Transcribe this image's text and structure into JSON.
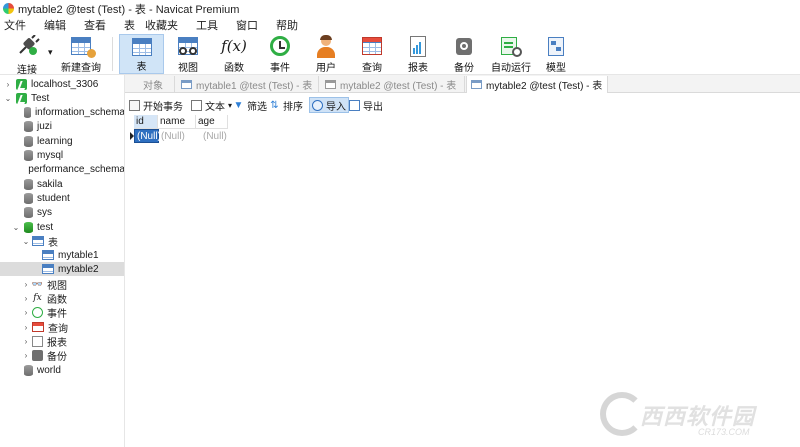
{
  "window": {
    "title": "mytable2 @test (Test) - 表 - Navicat Premium"
  },
  "menu": [
    "文件",
    "编辑",
    "查看",
    "表",
    "收藏夹",
    "工具",
    "窗口",
    "帮助"
  ],
  "ribbon": {
    "connect": "连接",
    "new_query": "新建查询",
    "table": "表",
    "view": "视图",
    "function": "函数",
    "event": "事件",
    "user": "用户",
    "query": "查询",
    "report": "报表",
    "backup": "备份",
    "automation": "自动运行",
    "model": "模型",
    "function_glyph": "f(x)"
  },
  "tree": {
    "items": [
      {
        "label": "localhost_3306",
        "type": "connection",
        "expand": "›"
      },
      {
        "label": "Test",
        "type": "connection",
        "expand": "⌄"
      },
      {
        "label": "information_schema",
        "type": "db"
      },
      {
        "label": "juzi",
        "type": "db"
      },
      {
        "label": "learning",
        "type": "db"
      },
      {
        "label": "mysql",
        "type": "db"
      },
      {
        "label": "performance_schema",
        "type": "db"
      },
      {
        "label": "sakila",
        "type": "db"
      },
      {
        "label": "student",
        "type": "db"
      },
      {
        "label": "sys",
        "type": "db"
      },
      {
        "label": "test",
        "type": "db-open",
        "expand": "⌄"
      },
      {
        "label": "表",
        "type": "folder-table",
        "expand": "⌄"
      },
      {
        "label": "mytable1",
        "type": "table"
      },
      {
        "label": "mytable2",
        "type": "table",
        "selected": true
      },
      {
        "label": "视图",
        "type": "folder",
        "expand": "›"
      },
      {
        "label": "函数",
        "type": "folder",
        "expand": "›"
      },
      {
        "label": "事件",
        "type": "folder",
        "expand": "›"
      },
      {
        "label": "查询",
        "type": "folder",
        "expand": "›"
      },
      {
        "label": "报表",
        "type": "folder",
        "expand": "›"
      },
      {
        "label": "备份",
        "type": "folder",
        "expand": "›"
      },
      {
        "label": "world",
        "type": "db"
      }
    ]
  },
  "tabs": [
    {
      "label": "对象",
      "active": false
    },
    {
      "label": "mytable1 @test (Test) - 表",
      "active": false
    },
    {
      "label": "mytable2 @test (Test) - 表",
      "active": false
    },
    {
      "label": "mytable2 @test (Test) - 表",
      "active": true
    }
  ],
  "editor_toolbar": {
    "begin_transaction": "开始事务",
    "text": "文本",
    "filter": "筛选",
    "sort": "排序",
    "import": "导入",
    "export": "导出"
  },
  "grid": {
    "columns": [
      "id",
      "name",
      "age"
    ],
    "rows": [
      [
        "(Null)",
        "(Null)",
        "(Null)"
      ]
    ]
  },
  "watermark": {
    "text": "西西软件园",
    "sub": "CR173.COM"
  },
  "colors": {
    "accent": "#2e6fc0",
    "ribbon_active": "#d0e4f7",
    "connection_green": "#2fae44"
  }
}
